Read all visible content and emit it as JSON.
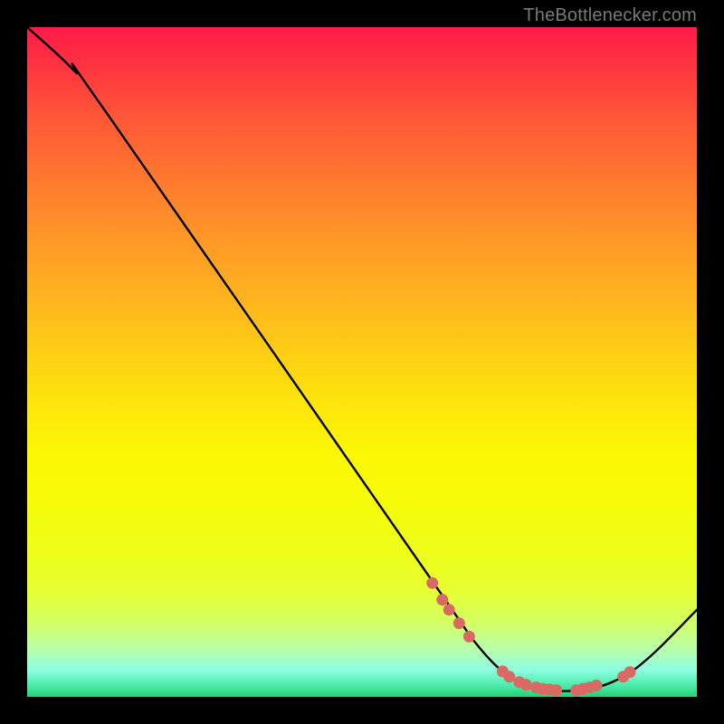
{
  "attribution": "TheBottlenecker.com",
  "colors": {
    "background": "#000000",
    "marker": "#d96a63",
    "curve": "#000000"
  },
  "chart_data": {
    "type": "line",
    "title": "",
    "xlabel": "",
    "ylabel": "",
    "xlim": [
      0,
      100
    ],
    "ylim": [
      0,
      100
    ],
    "note": "Axes unlabeled; values are visual-coordinate estimates in percent of plot area (x left→right 0–100, y bottom→top 0–100).",
    "curve_points": [
      {
        "x": 0.0,
        "y": 100.0
      },
      {
        "x": 7.0,
        "y": 93.5
      },
      {
        "x": 12.0,
        "y": 87.0
      },
      {
        "x": 60.0,
        "y": 18.0
      },
      {
        "x": 67.0,
        "y": 8.0
      },
      {
        "x": 72.0,
        "y": 3.0
      },
      {
        "x": 76.0,
        "y": 1.2
      },
      {
        "x": 82.5,
        "y": 1.0
      },
      {
        "x": 88.0,
        "y": 2.5
      },
      {
        "x": 93.0,
        "y": 6.0
      },
      {
        "x": 100.0,
        "y": 13.0
      }
    ],
    "markers": [
      {
        "x": 60.5,
        "y": 17.0
      },
      {
        "x": 62.0,
        "y": 14.5
      },
      {
        "x": 63.0,
        "y": 13.0
      },
      {
        "x": 64.5,
        "y": 11.0
      },
      {
        "x": 66.0,
        "y": 9.0
      },
      {
        "x": 71.0,
        "y": 3.8
      },
      {
        "x": 72.0,
        "y": 3.0
      },
      {
        "x": 73.5,
        "y": 2.2
      },
      {
        "x": 74.5,
        "y": 1.8
      },
      {
        "x": 76.0,
        "y": 1.4
      },
      {
        "x": 77.0,
        "y": 1.2
      },
      {
        "x": 78.0,
        "y": 1.1
      },
      {
        "x": 79.0,
        "y": 1.0
      },
      {
        "x": 82.0,
        "y": 1.0
      },
      {
        "x": 83.0,
        "y": 1.2
      },
      {
        "x": 84.0,
        "y": 1.4
      },
      {
        "x": 85.0,
        "y": 1.7
      },
      {
        "x": 89.0,
        "y": 3.0
      },
      {
        "x": 90.0,
        "y": 3.7
      }
    ]
  }
}
